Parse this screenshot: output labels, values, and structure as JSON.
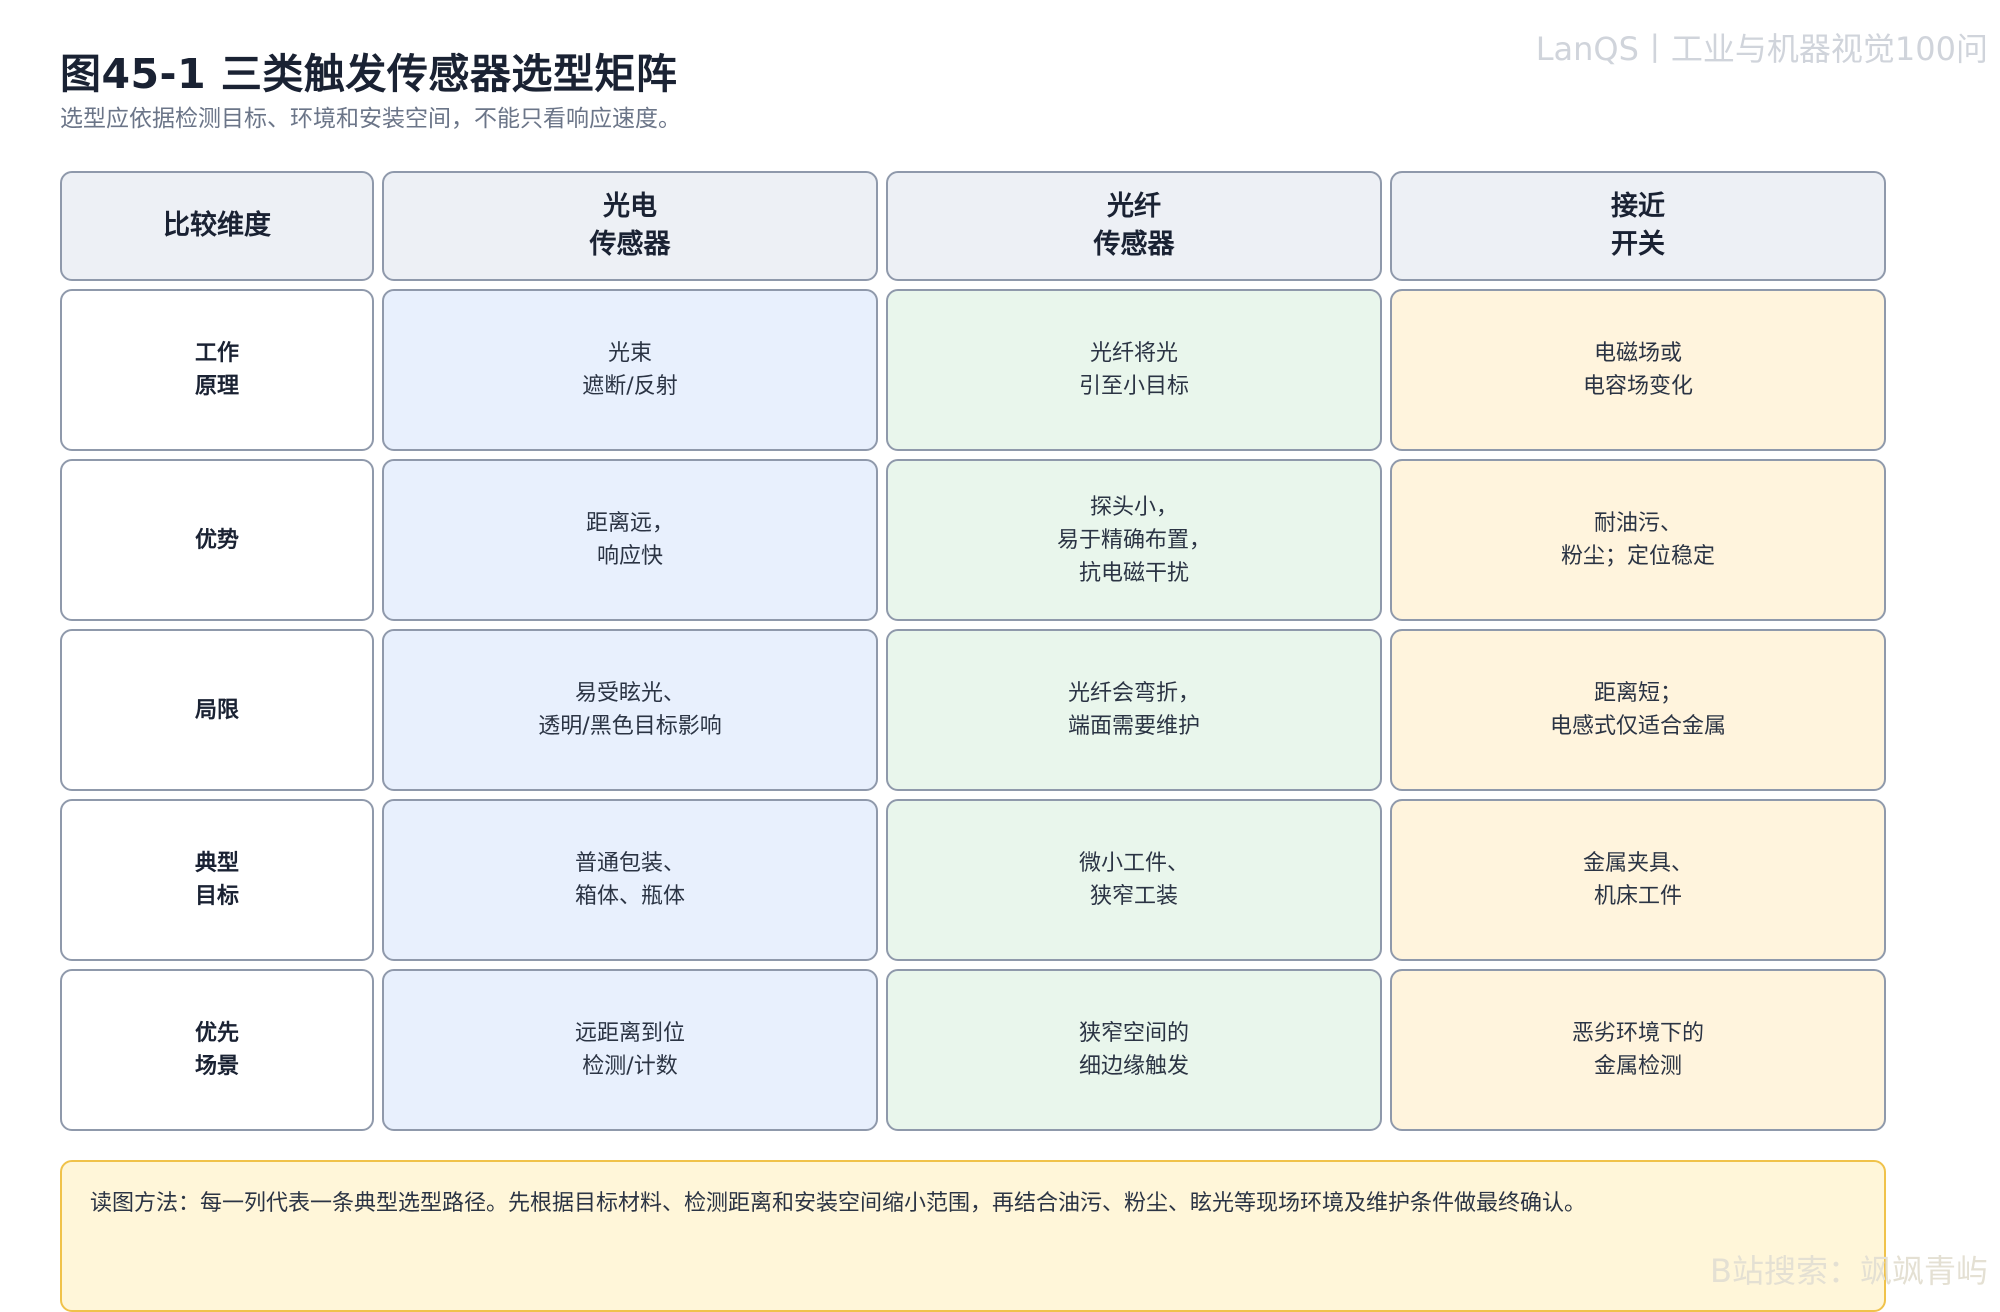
{
  "title": "图45-1 三类触发传感器选型矩阵",
  "subtitle": "选型应依据检测目标、环境和安装空间，不能只看响应速度。",
  "watermark_top": "LanQS丨工业与机器视觉100问",
  "watermark_bottom": "B站搜索：飒飒青屿",
  "matrix": {
    "corner": "比较维度",
    "columns": [
      "光电\n传感器",
      "光纤\n传感器",
      "接近\n开关"
    ],
    "column_colors": [
      "#e8f0fd",
      "#e9f6ec",
      "#fff4dd"
    ],
    "rows": [
      {
        "label": "工作\n原理",
        "cells": [
          "光束\n遮断/反射",
          "光纤将光\n引至小目标",
          "电磁场或\n电容场变化"
        ]
      },
      {
        "label": "优势",
        "cells": [
          "距离远，\n响应快",
          "探头小，\n易于精确布置，\n抗电磁干扰",
          "耐油污、\n粉尘；定位稳定"
        ]
      },
      {
        "label": "局限",
        "cells": [
          "易受眩光、\n透明/黑色目标影响",
          "光纤会弯折，\n端面需要维护",
          "距离短；\n电感式仅适合金属"
        ]
      },
      {
        "label": "典型\n目标",
        "cells": [
          "普通包装、\n箱体、瓶体",
          "微小工件、\n狭窄工装",
          "金属夹具、\n机床工件"
        ]
      },
      {
        "label": "优先\n场景",
        "cells": [
          "远距离到位\n检测/计数",
          "狭窄空间的\n细边缘触发",
          "恶劣环境下的\n金属检测"
        ]
      }
    ]
  },
  "note": "读图方法：每一列代表一条典型选型路径。先根据目标材料、检测距离和安装空间缩小范围，再结合油污、粉尘、眩光等现场环境及维护条件做最终确认。"
}
